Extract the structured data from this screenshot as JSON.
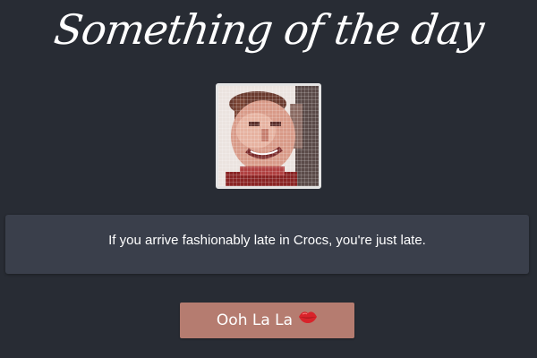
{
  "header": {
    "title": "Something of the day"
  },
  "portrait": {
    "icon": "pixelated-face-photo"
  },
  "quote": {
    "text": "If you arrive fashionably late in Crocs, you're just late."
  },
  "action": {
    "label": "Ooh La La",
    "icon": "kiss-lips-icon",
    "color": "#b57c70"
  },
  "colors": {
    "background": "#282c34",
    "card": "#3a3f4b"
  }
}
